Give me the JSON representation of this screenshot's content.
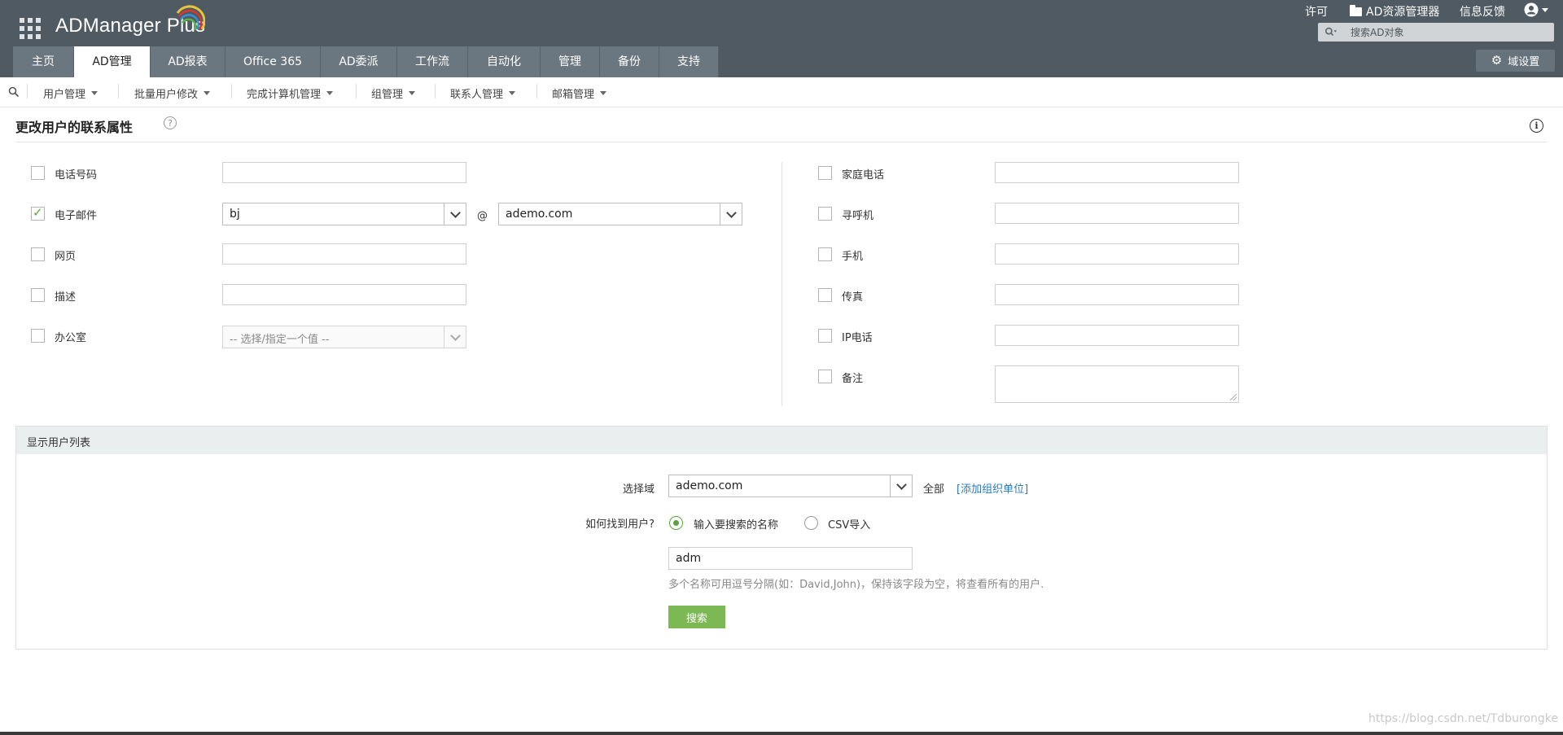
{
  "header": {
    "logo": "ADManager Plus",
    "top_links": {
      "license": "许可",
      "ad_explorer": "AD资源管理器",
      "feedback": "信息反馈"
    },
    "search_placeholder": "搜索AD对象",
    "tabs": [
      "主页",
      "AD管理",
      "AD报表",
      "Office 365",
      "AD委派",
      "工作流",
      "自动化",
      "管理",
      "备份",
      "支持"
    ],
    "active_tab": "AD管理",
    "domain_settings": "域设置"
  },
  "submenu": [
    "用户管理",
    "批量用户修改",
    "完成计算机管理",
    "组管理",
    "联系人管理",
    "邮箱管理"
  ],
  "page": {
    "title": "更改用户的联系属性",
    "help": "?",
    "info": "i"
  },
  "form_left": {
    "phone": {
      "label": "电话号码",
      "value": ""
    },
    "email": {
      "label": "电子邮件",
      "user": "bj",
      "at": "@",
      "domain": "ademo.com"
    },
    "webpage": {
      "label": "网页",
      "value": ""
    },
    "description": {
      "label": "描述",
      "value": ""
    },
    "office": {
      "label": "办公室",
      "placeholder": "-- 选择/指定一个值 --"
    }
  },
  "form_right": {
    "home_phone": {
      "label": "家庭电话",
      "value": ""
    },
    "pager": {
      "label": "寻呼机",
      "value": ""
    },
    "mobile": {
      "label": "手机",
      "value": ""
    },
    "fax": {
      "label": "传真",
      "value": ""
    },
    "ip_phone": {
      "label": "IP电话",
      "value": ""
    },
    "notes": {
      "label": "备注",
      "value": ""
    }
  },
  "userlist": {
    "header": "显示用户列表",
    "domain_label": "选择域",
    "domain_value": "ademo.com",
    "all_label": "全部",
    "add_ou": "[添加组织单位]",
    "find_label": "如何找到用户?",
    "option_names": "输入要搜索的名称",
    "option_csv": "CSV导入",
    "search_value": "adm",
    "hint": "多个名称可用逗号分隔(如：David,John)，保持该字段为空，将查看所有的用户.",
    "search_button": "搜索"
  },
  "watermark": "https://blog.csdn.net/Tdburongke"
}
